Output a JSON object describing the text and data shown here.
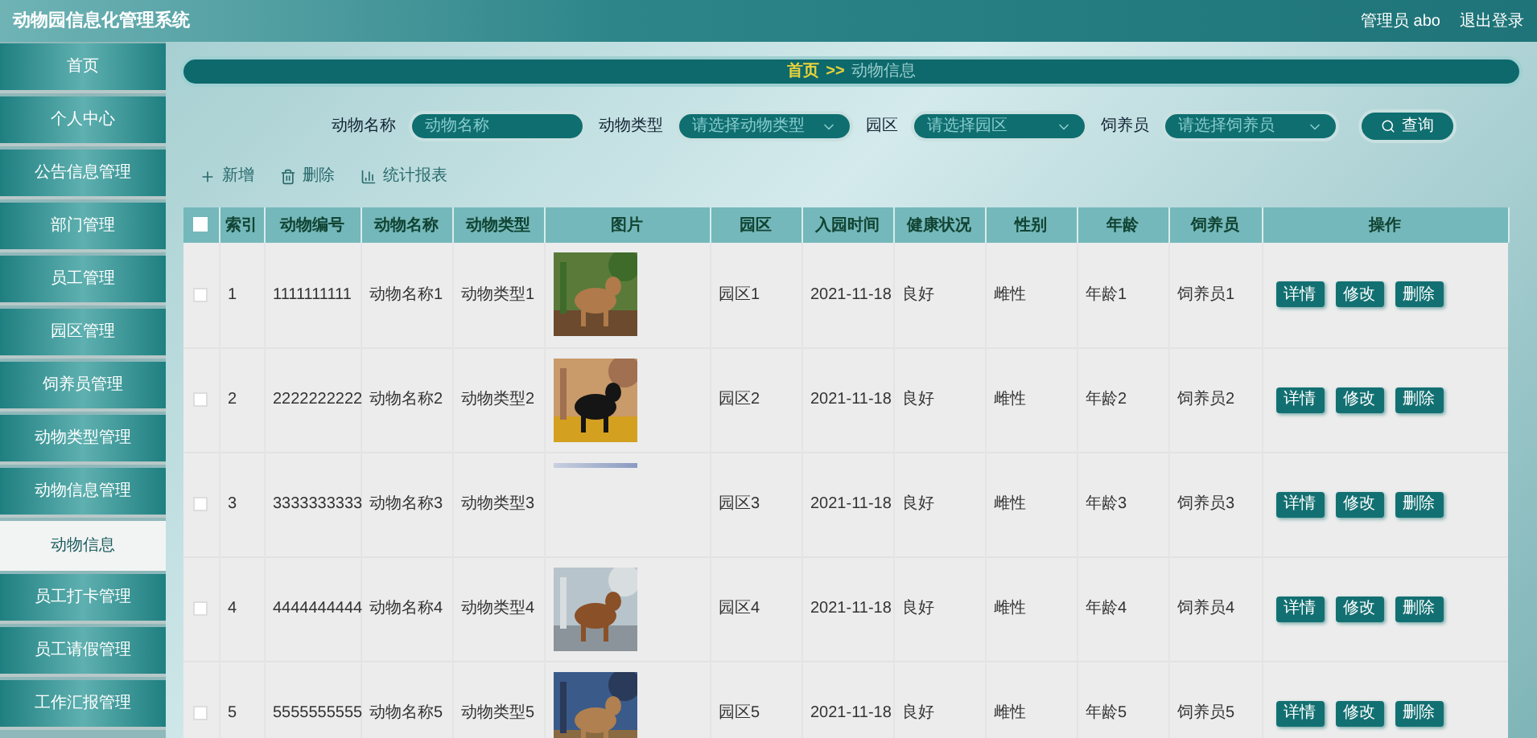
{
  "header": {
    "title": "动物园信息化管理系统",
    "user": "管理员 abo",
    "logout": "退出登录"
  },
  "sidebar": {
    "items": [
      {
        "label": "首页",
        "selected": false
      },
      {
        "label": "个人中心",
        "selected": false
      },
      {
        "label": "公告信息管理",
        "selected": false
      },
      {
        "label": "部门管理",
        "selected": false
      },
      {
        "label": "员工管理",
        "selected": false
      },
      {
        "label": "园区管理",
        "selected": false
      },
      {
        "label": "饲养员管理",
        "selected": false
      },
      {
        "label": "动物类型管理",
        "selected": false
      },
      {
        "label": "动物信息管理",
        "selected": false
      },
      {
        "label": "动物信息",
        "selected": true
      },
      {
        "label": "员工打卡管理",
        "selected": false
      },
      {
        "label": "员工请假管理",
        "selected": false
      },
      {
        "label": "工作汇报管理",
        "selected": false
      }
    ]
  },
  "breadcrumb": {
    "home": "首页",
    "separator": ">>",
    "current": "动物信息"
  },
  "search": {
    "fields": [
      {
        "kind": "input",
        "label": "动物名称",
        "placeholder": "动物名称"
      },
      {
        "kind": "select",
        "label": "动物类型",
        "placeholder": "请选择动物类型"
      },
      {
        "kind": "select",
        "label": "园区",
        "placeholder": "请选择园区"
      },
      {
        "kind": "select",
        "label": "饲养员",
        "placeholder": "请选择饲养员"
      }
    ],
    "button": "查询"
  },
  "actions": [
    {
      "kind": "add",
      "label": "新增"
    },
    {
      "kind": "delete",
      "label": "删除"
    },
    {
      "kind": "chart",
      "label": "统计报表"
    }
  ],
  "table": {
    "select_all_checked": false,
    "columns": [
      "索引",
      "动物编号",
      "动物名称",
      "动物类型",
      "图片",
      "园区",
      "入园时间",
      "健康状况",
      "性别",
      "年龄",
      "饲养员",
      "操作"
    ],
    "rows": [
      {
        "checked": false,
        "cells": [
          "1",
          "1111111111",
          "动物名称1",
          "动物类型1"
        ],
        "photo": {
          "kind": "picture"
        },
        "rest": [
          "园区1",
          "2021-11-18",
          "良好",
          "雌性",
          "年龄1",
          "饲养员1"
        ],
        "buttons": [
          "详情",
          "修改",
          "删除"
        ]
      },
      {
        "checked": false,
        "cells": [
          "2",
          "2222222222",
          "动物名称2",
          "动物类型2"
        ],
        "photo": {
          "kind": "picture"
        },
        "rest": [
          "园区2",
          "2021-11-18",
          "良好",
          "雌性",
          "年龄2",
          "饲养员2"
        ],
        "buttons": [
          "详情",
          "修改",
          "删除"
        ]
      },
      {
        "checked": false,
        "cells": [
          "3",
          "3333333333",
          "动物名称3",
          "动物类型3"
        ],
        "photo": {
          "kind": "strip"
        },
        "rest": [
          "园区3",
          "2021-11-18",
          "良好",
          "雌性",
          "年龄3",
          "饲养员3"
        ],
        "buttons": [
          "详情",
          "修改",
          "删除"
        ]
      },
      {
        "checked": false,
        "cells": [
          "4",
          "4444444444",
          "动物名称4",
          "动物类型4"
        ],
        "photo": {
          "kind": "picture"
        },
        "rest": [
          "园区4",
          "2021-11-18",
          "良好",
          "雌性",
          "年龄4",
          "饲养员4"
        ],
        "buttons": [
          "详情",
          "修改",
          "删除"
        ]
      },
      {
        "checked": false,
        "cells": [
          "5",
          "5555555555",
          "动物名称5",
          "动物类型5"
        ],
        "photo": {
          "kind": "picture"
        },
        "rest": [
          "园区5",
          "2021-11-18",
          "良好",
          "雌性",
          "年龄5",
          "饲养员5"
        ],
        "buttons": [
          "详情",
          "修改",
          "删除"
        ]
      }
    ]
  }
}
